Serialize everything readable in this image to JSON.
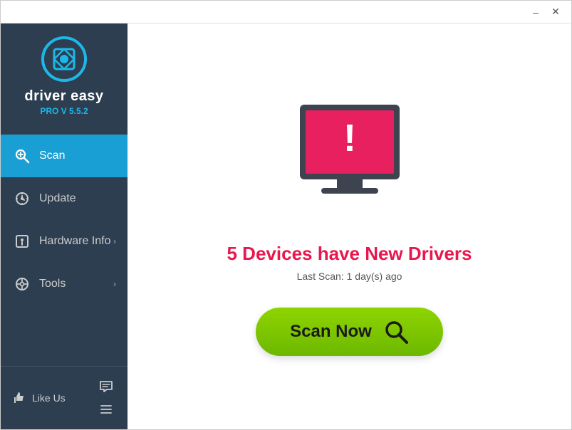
{
  "titlebar": {
    "minimize_label": "–",
    "close_label": "✕"
  },
  "sidebar": {
    "app_name": "driver easy",
    "app_version": "PRO V 5.5.2",
    "nav_items": [
      {
        "id": "scan",
        "label": "Scan",
        "active": true,
        "has_chevron": false
      },
      {
        "id": "update",
        "label": "Update",
        "active": false,
        "has_chevron": false
      },
      {
        "id": "hardware-info",
        "label": "Hardware Info",
        "active": false,
        "has_chevron": true
      },
      {
        "id": "tools",
        "label": "Tools",
        "active": false,
        "has_chevron": true
      }
    ],
    "footer": {
      "like_label": "Like Us"
    }
  },
  "content": {
    "status_title": "5 Devices have New Drivers",
    "last_scan_label": "Last Scan: 1 day(s) ago",
    "scan_button_label": "Scan Now"
  }
}
